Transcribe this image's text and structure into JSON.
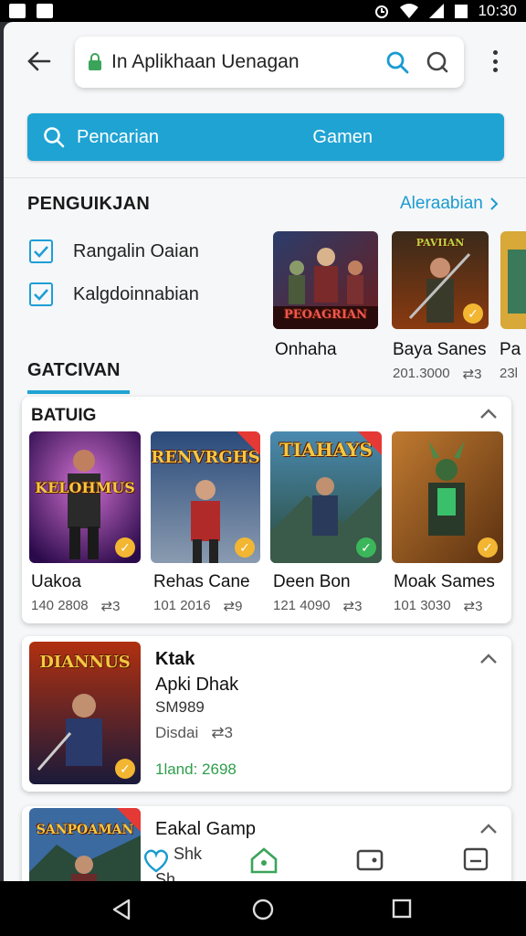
{
  "status_bar": {
    "time": "10:30",
    "colors": {
      "background": "#000000",
      "text": "#ffffff"
    }
  },
  "top_bar": {
    "url_text": "In Aplikhaan Uenagan",
    "icons": [
      "back-arrow-icon",
      "lock-icon",
      "search-icon",
      "lens-icon",
      "more-vert-icon"
    ]
  },
  "search": {
    "left_label": "Pencarian",
    "right_label": "Gamen",
    "color": "#1fa3d3"
  },
  "section": {
    "title": "PENGUIKJAN",
    "more_label": "Aleraabian",
    "checks": [
      {
        "label": "Rangalin Oaian",
        "checked": true
      },
      {
        "label": "Kalgdoinnabian",
        "checked": true
      }
    ],
    "featured": [
      {
        "art_title": "PEOAGRIAN",
        "name": "Onhaha",
        "meta": ""
      },
      {
        "art_title": "PAVIIAN",
        "name": "Baya Sanes",
        "meta": "201.3000",
        "count": "3"
      },
      {
        "art_title": "",
        "name": "Pa",
        "meta": "23l"
      }
    ]
  },
  "tab": {
    "title": "GATCIVAN"
  },
  "card_batuig": {
    "title": "BATUIG",
    "games": [
      {
        "art_title": "KELOHMUS",
        "name": "Uakoa",
        "meta": "140 2808",
        "count": "3"
      },
      {
        "art_title": "RENVRGHS",
        "name": "Rehas Cane",
        "meta": "101 2016",
        "count": "9"
      },
      {
        "art_title": "TIAHAYS",
        "name": "Deen Bon",
        "meta": "121 4090",
        "count": "3"
      },
      {
        "art_title": "",
        "name": "Moak Sames",
        "meta": "101 3030",
        "count": "3"
      }
    ]
  },
  "card_detail": {
    "art_title": "DIANNUS",
    "title": "Ktak",
    "line1": "Apki Dhak",
    "line2": "SM989",
    "line3": "Disdai",
    "count": "3",
    "price": "1land: 2698",
    "price_color": "#2e9e4b"
  },
  "card_partial": {
    "art_title": "SANPOAMAN",
    "title": "Eakal Gamp",
    "line1": "Shk",
    "line2": "Sh"
  },
  "bottom_nav": [
    "heart-icon",
    "home-icon",
    "wallet-icon",
    "tablet-icon"
  ],
  "system_nav": [
    "back-triangle-icon",
    "home-circle-icon",
    "recents-square-icon"
  ]
}
